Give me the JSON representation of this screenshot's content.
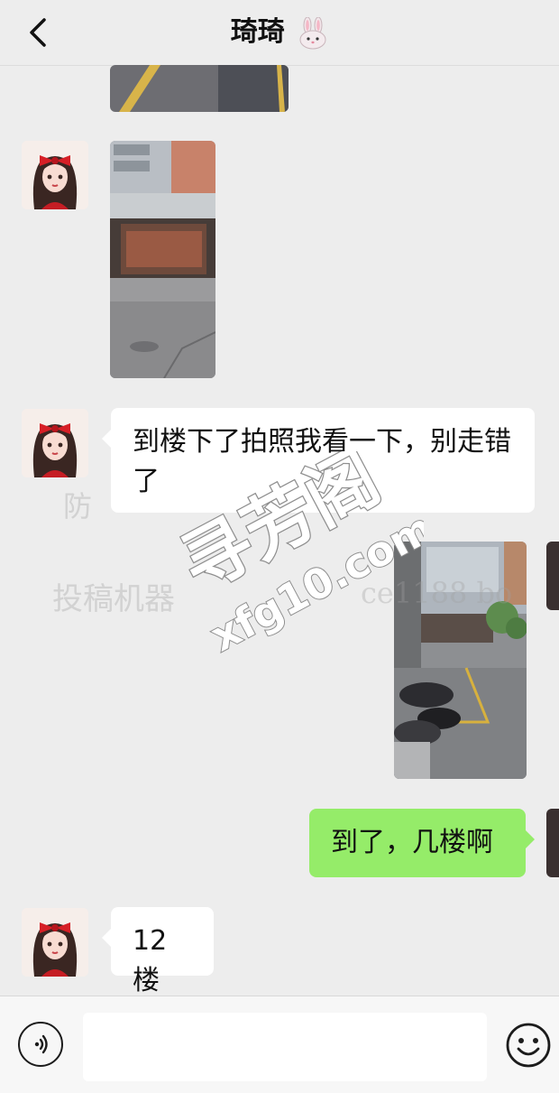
{
  "header": {
    "title": "琦琦",
    "back_icon": "chevron-left-icon",
    "title_icon": "rabbit-icon"
  },
  "messages": [
    {
      "side": "left",
      "type": "image",
      "description_icon": "photo-parking-lot"
    },
    {
      "side": "left",
      "type": "image",
      "description_icon": "photo-building-entrance"
    },
    {
      "side": "left",
      "type": "text",
      "text": "到楼下了拍照我看一下，别走错了"
    },
    {
      "side": "right",
      "type": "image",
      "description_icon": "photo-street-scooters"
    },
    {
      "side": "right",
      "type": "text",
      "text": "到了，几楼啊"
    },
    {
      "side": "left",
      "type": "text",
      "text": "12楼"
    }
  ],
  "watermarks": {
    "line1": "防",
    "line2": "投稿机器",
    "line2_tail": "ce1188 bo",
    "logo_main": "寻芳阁",
    "logo_domain": "xfg10.com"
  },
  "input_bar": {
    "placeholder": "",
    "voice_icon": "voice-icon",
    "emoji_icon": "emoji-icon"
  },
  "colors": {
    "background": "#ededed",
    "sent_bubble": "#95ec69",
    "received_bubble": "#ffffff"
  }
}
